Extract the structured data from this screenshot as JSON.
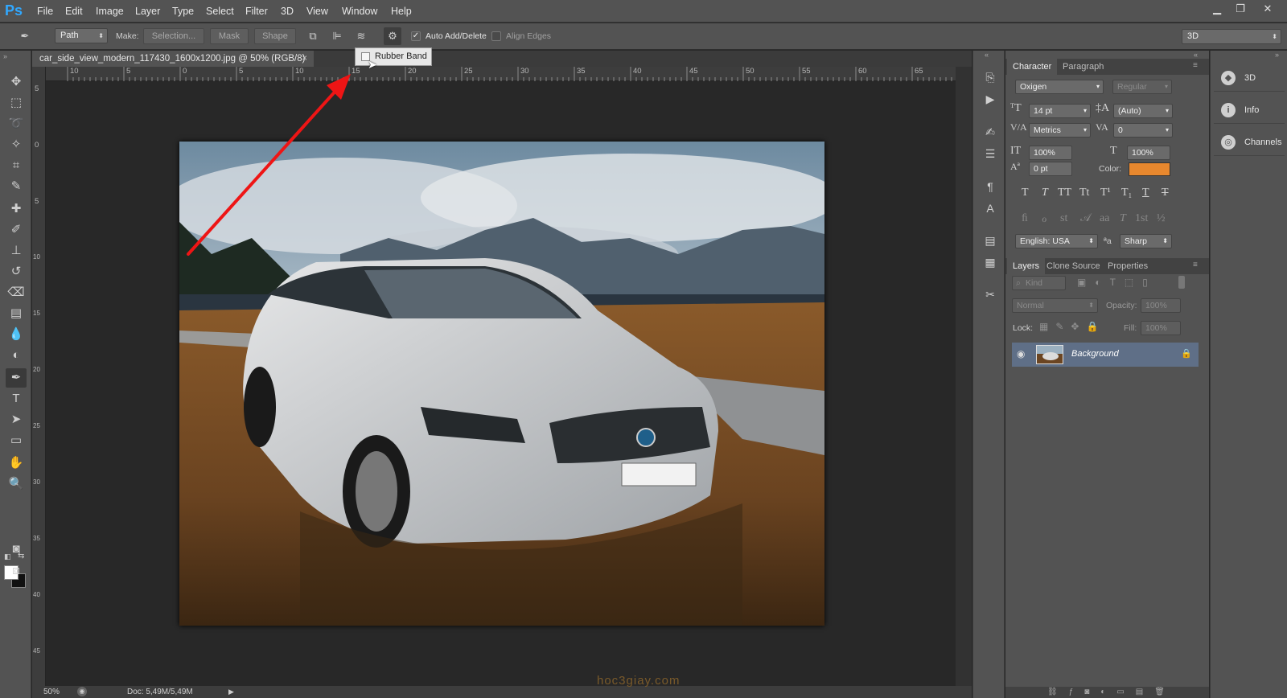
{
  "app": {
    "logo": "Ps"
  },
  "menu": [
    "File",
    "Edit",
    "Image",
    "Layer",
    "Type",
    "Select",
    "Filter",
    "3D",
    "View",
    "Window",
    "Help"
  ],
  "window_controls": {
    "minimize": "▁",
    "restore": "❐",
    "close": "✕"
  },
  "options_bar": {
    "tool_mode": "Path",
    "make_label": "Make:",
    "selection_btn": "Selection...",
    "mask_btn": "Mask",
    "shape_btn": "Shape",
    "auto_add_delete": "Auto Add/Delete",
    "auto_add_delete_checked": true,
    "align_edges": "Align Edges",
    "align_edges_checked": false,
    "workspace": "3D"
  },
  "tooltip": {
    "label": "Rubber Band",
    "checked": false
  },
  "document": {
    "tab_title": "car_side_view_modern_117430_1600x1200.jpg @ 50% (RGB/8)",
    "tab_close": "×"
  },
  "rulers": {
    "top": [
      "10",
      "5",
      "0",
      "5",
      "10",
      "15",
      "20",
      "25",
      "30",
      "35",
      "40",
      "45",
      "50",
      "55",
      "60",
      "65"
    ],
    "left": [
      "5",
      "0",
      "5",
      "10",
      "15",
      "20",
      "25",
      "30",
      "35",
      "40",
      "45"
    ]
  },
  "status": {
    "zoom": "50%",
    "doc": "Doc: 5,49M/5,49M"
  },
  "watermark": "hoc3giay.com",
  "character_panel": {
    "tabs": [
      "Character",
      "Paragraph"
    ],
    "font_family": "Oxigen",
    "font_style": "Regular",
    "font_size": "14 pt",
    "leading": "(Auto)",
    "kerning": "Metrics",
    "tracking": "0",
    "vertical_scale": "100%",
    "horizontal_scale": "100%",
    "baseline_shift": "0 pt",
    "color_label": "Color:",
    "color": "#e8882e",
    "style_buttons": [
      "T",
      "T",
      "TT",
      "Tt",
      "T¹",
      "T₁",
      "T",
      "T"
    ],
    "opentype_buttons": [
      "ﬁ",
      "ℴ",
      "st",
      "𝒜",
      "aa",
      "T",
      "1st",
      "½"
    ],
    "language": "English: USA",
    "aa_label": "ªa",
    "antialias": "Sharp"
  },
  "layers_panel": {
    "tabs": [
      "Layers",
      "Clone Source",
      "Properties"
    ],
    "filter": "Kind",
    "blend_mode": "Normal",
    "opacity_label": "Opacity:",
    "opacity": "100%",
    "lock_label": "Lock:",
    "fill_label": "Fill:",
    "fill": "100%",
    "layers": [
      {
        "name": "Background",
        "visible": true,
        "locked": true
      }
    ]
  },
  "right_column": [
    "3D",
    "Info",
    "Channels"
  ]
}
